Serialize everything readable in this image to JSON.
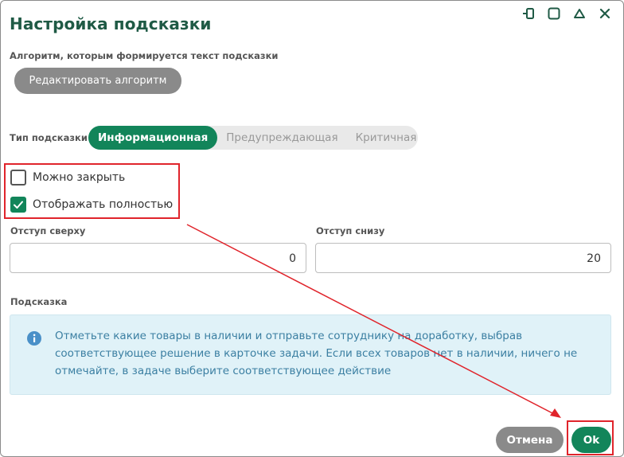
{
  "dialog": {
    "title": "Настройка подсказки",
    "algorithm_label": "Алгоритм, которым формируется текст подсказки",
    "edit_algorithm_button": "Редактировать алгоритм",
    "hint_type_label": "Тип подсказки",
    "hint_types": [
      "Информационная",
      "Предупреждающая",
      "Критичная"
    ],
    "selected_hint_type": "Информационная",
    "checkboxes": [
      {
        "label": "Можно закрыть",
        "checked": false
      },
      {
        "label": "Отображать полностью",
        "checked": true
      }
    ],
    "offset_top_label": "Отступ сверху",
    "offset_top_value": "0",
    "offset_bottom_label": "Отступ снизу",
    "offset_bottom_value": "20",
    "hint_label": "Подсказка",
    "hint_text": "Отметьте какие товары в наличии и отправьте сотруднику на доработку, выбрав соответствующее решение в карточке задачи. Если всех товаров нет в наличии, ничего не отмечайте, в задаче выберите соответствующее действие",
    "cancel_button": "Отмена",
    "ok_button": "Ok"
  },
  "colors": {
    "accent": "#12855a",
    "title": "#1f5a45",
    "annotation": "#e0242b",
    "hint_bg": "#e0f2f8",
    "hint_text": "#3b7fa2",
    "gray_button": "#8a8a8a"
  },
  "icons": [
    "pin-icon",
    "maximize-icon",
    "collapse-icon",
    "close-icon",
    "info-icon",
    "checkmark-icon"
  ]
}
